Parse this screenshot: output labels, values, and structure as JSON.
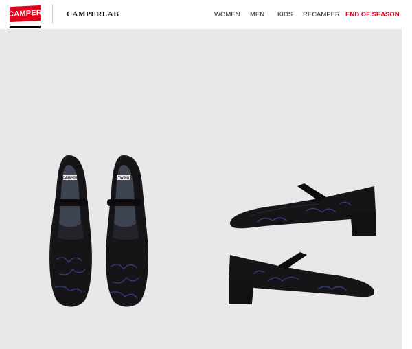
{
  "header": {
    "logo_text": "CAMPER",
    "brand": "CAMPERLAB",
    "nav": [
      {
        "label": "WOMEN"
      },
      {
        "label": "MEN"
      },
      {
        "label": "KIDS"
      },
      {
        "label": "RECAMPER"
      },
      {
        "label": "END OF SEASON",
        "color": "#e2001a"
      }
    ]
  },
  "gallery": {
    "images": [
      {
        "name": "shoes-top-view",
        "insole_labels": [
          "CAMPER",
          "TWINS"
        ]
      },
      {
        "name": "shoes-side-view"
      }
    ]
  },
  "colors": {
    "accent": "#e2001a",
    "gallery_bg": "#e8e8eb",
    "shoe": "#151417",
    "embroidery": "#3a3f8c"
  }
}
